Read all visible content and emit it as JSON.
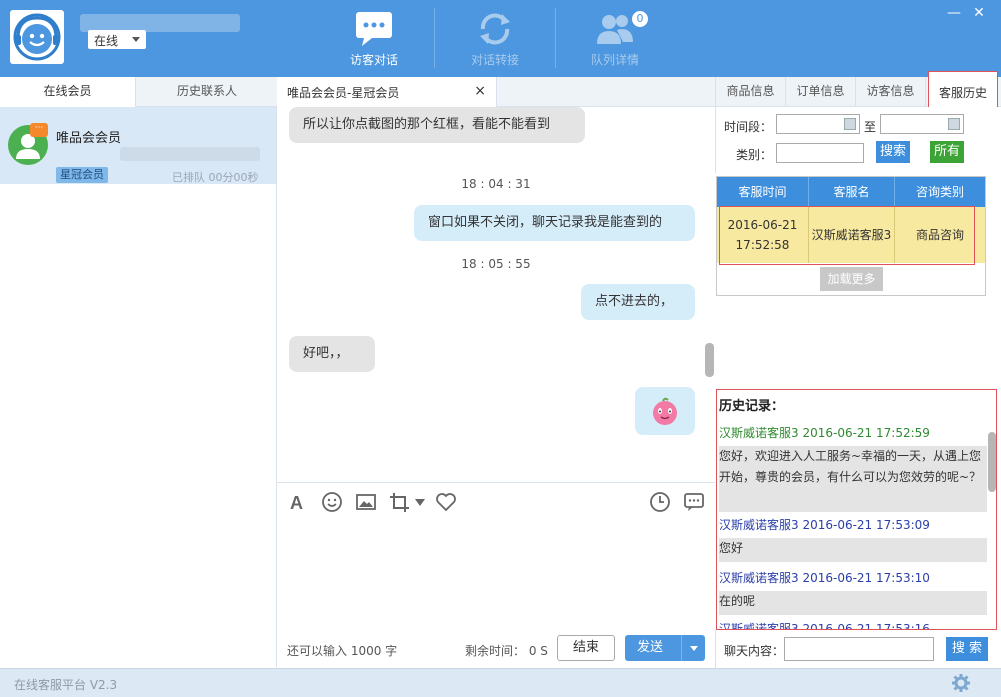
{
  "header": {
    "status": "在线",
    "buttons": [
      {
        "label": "访客对话"
      },
      {
        "label": "对话转接"
      },
      {
        "label": "队列详情"
      }
    ],
    "queue_badge": "0",
    "minimize": "—",
    "close": "✕"
  },
  "left": {
    "tabs": [
      "在线会员",
      "历史联系人"
    ],
    "member": {
      "name": "唯品会会员",
      "badge": "星冠会员",
      "wait": "已排队 00分00秒",
      "chat_icon": "···"
    }
  },
  "chat": {
    "tab_title": "唯品会会员-星冠会员",
    "tab_close": "×",
    "messages": [
      {
        "dir": "in",
        "text": "所以让你点截图的那个红框，看能不能看到"
      },
      {
        "time": "18 : 04 : 31"
      },
      {
        "dir": "out",
        "text": "窗口如果不关闭，聊天记录我是能查到的"
      },
      {
        "time": "18 : 05 : 55"
      },
      {
        "dir": "out",
        "text": "点不进去的，"
      },
      {
        "dir": "in",
        "text": "好吧，，"
      }
    ],
    "char_hint": "还可以输入 1000 字",
    "remain_time": "剩余时间： 0 S",
    "end_label": "结束",
    "send_label": "发送"
  },
  "right": {
    "tabs": [
      "商品信息",
      "订单信息",
      "访客信息",
      "客服历史"
    ],
    "filter": {
      "period_label": "时间段：",
      "to_label": "至",
      "type_label": "类别：",
      "search": "搜索",
      "all": "所有"
    },
    "table": {
      "headers": [
        "客服时间",
        "客服名",
        "咨询类别"
      ],
      "rows": [
        [
          "2016-06-21 17:52:58",
          "汉斯威诺客服3",
          "商品咨询"
        ]
      ],
      "load_more": "加载更多"
    },
    "history": {
      "title": "历史记录：",
      "records": [
        {
          "head": "汉斯威诺客服3  2016-06-21 17:52:59",
          "body": "您好，欢迎进入人工服务~幸福的一天，从遇上您开始，尊贵的会员，有什么可以为您效劳的呢~？"
        },
        {
          "head": "汉斯威诺客服3  2016-06-21 17:53:09",
          "body": "您好"
        },
        {
          "head": "汉斯威诺客服3  2016-06-21 17:53:10",
          "body": "在的呢"
        },
        {
          "head": "汉斯威诺客服3  2016-06-21 17:53:16",
          "body": ""
        }
      ]
    },
    "chat_search": {
      "label": "聊天内容：",
      "button": "搜 索"
    }
  },
  "statusbar": {
    "version": "在线客服平台 V2.3"
  },
  "colors": {
    "brand": "#4c97df",
    "highlight": "#e0515a",
    "row": "#f8e9a0",
    "green": "#3ca336"
  }
}
